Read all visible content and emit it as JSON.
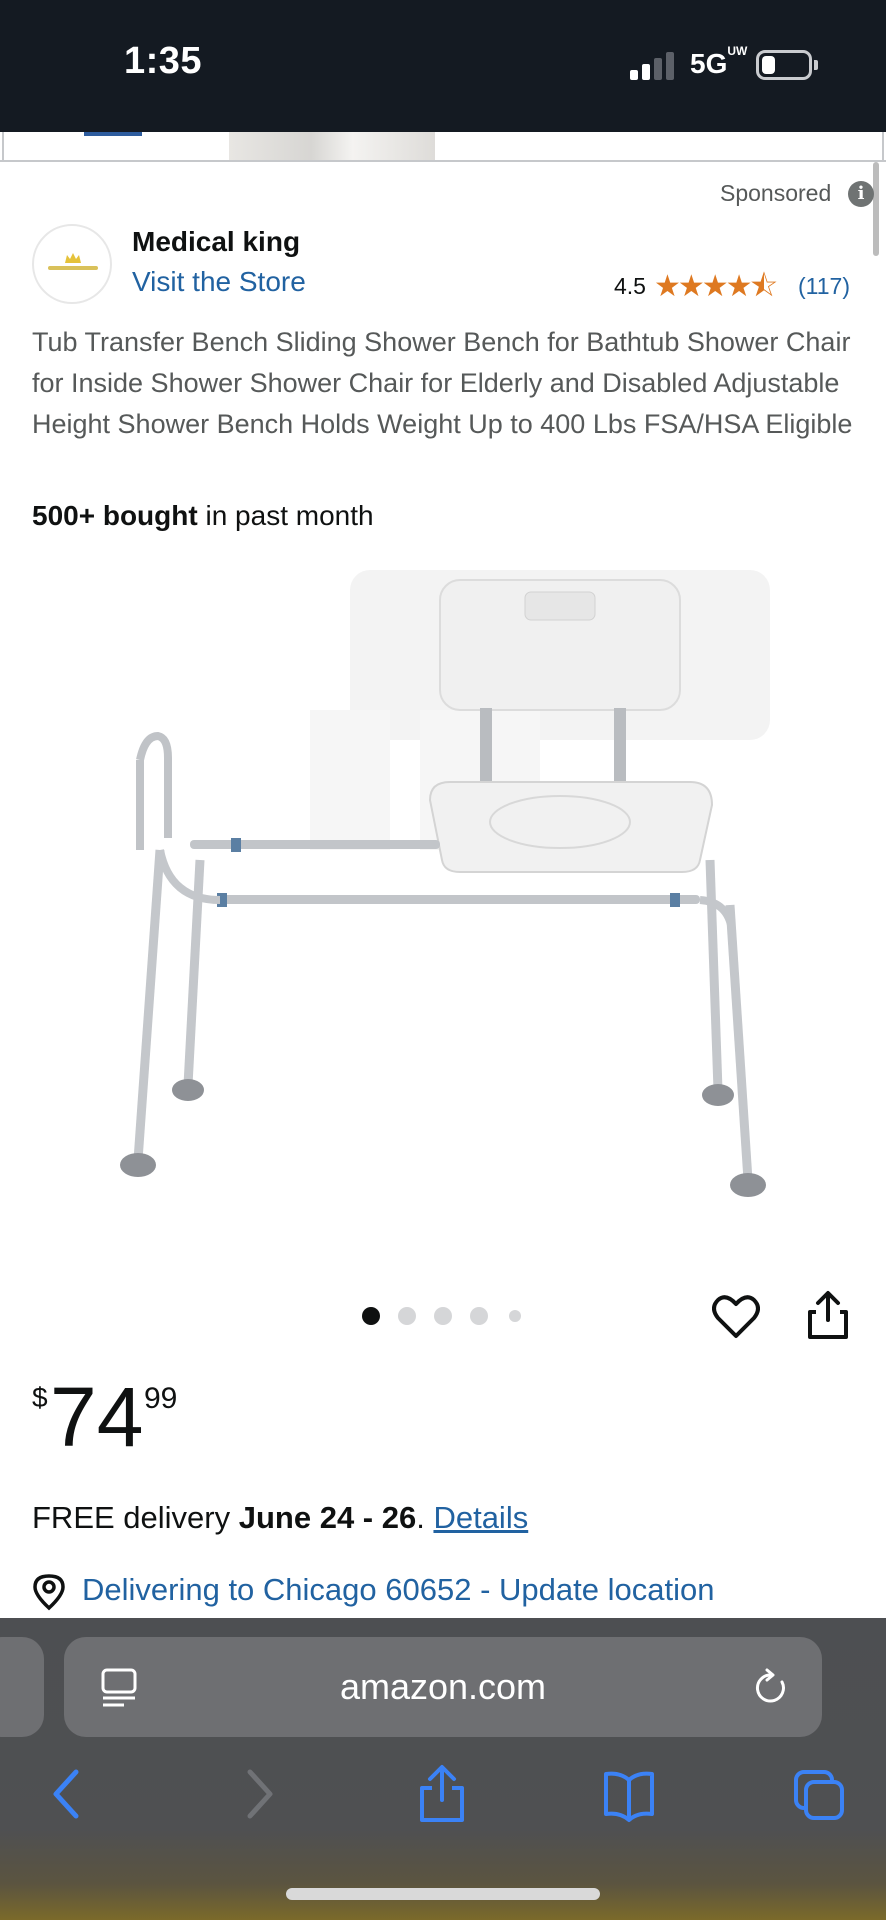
{
  "status_bar": {
    "time": "1:35",
    "network": "5G",
    "network_suffix": "UW",
    "battery_level": 0.2
  },
  "header": {
    "sponsored": "Sponsored"
  },
  "store": {
    "name": "Medical king",
    "link": "Visit the Store",
    "rating": "4.5",
    "stars_filled": 4.5,
    "stars": "★★★★⯪",
    "review_count": "(117)"
  },
  "product": {
    "title": "Tub Transfer Bench Sliding Shower Bench for Bathtub Shower Chair for Inside Shower Shower Chair for Elderly and Disabled Adjustable Height Shower Bench Holds Weight Up to 400 Lbs FSA/HSA Eligible",
    "bought_bold": "500+ bought",
    "bought_rest": " in past month",
    "image_count": 5,
    "active_image": 1
  },
  "price": {
    "symbol": "$",
    "whole": "74",
    "fraction": "99"
  },
  "delivery": {
    "prefix": "FREE delivery ",
    "dates": "June 24 - 26",
    "separator": ". ",
    "details_link": "Details"
  },
  "location": {
    "text": "Delivering to Chicago 60652 - Update location"
  },
  "browser": {
    "url": "amazon.com"
  },
  "colors": {
    "link": "#2162a1",
    "star": "#de7921",
    "status_bar": "#141a22",
    "safari_bar": "#4d4f52",
    "ios_blue": "#3b82f6"
  },
  "icons": {
    "info": "info-icon",
    "heart": "heart-icon",
    "share": "share-icon",
    "location": "location-pin-icon",
    "reader": "reader-mode-icon",
    "reload": "reload-icon",
    "back": "chevron-left-icon",
    "forward": "chevron-right-icon",
    "safari_share": "share-icon",
    "bookmarks": "book-icon",
    "tabs": "tabs-icon"
  }
}
